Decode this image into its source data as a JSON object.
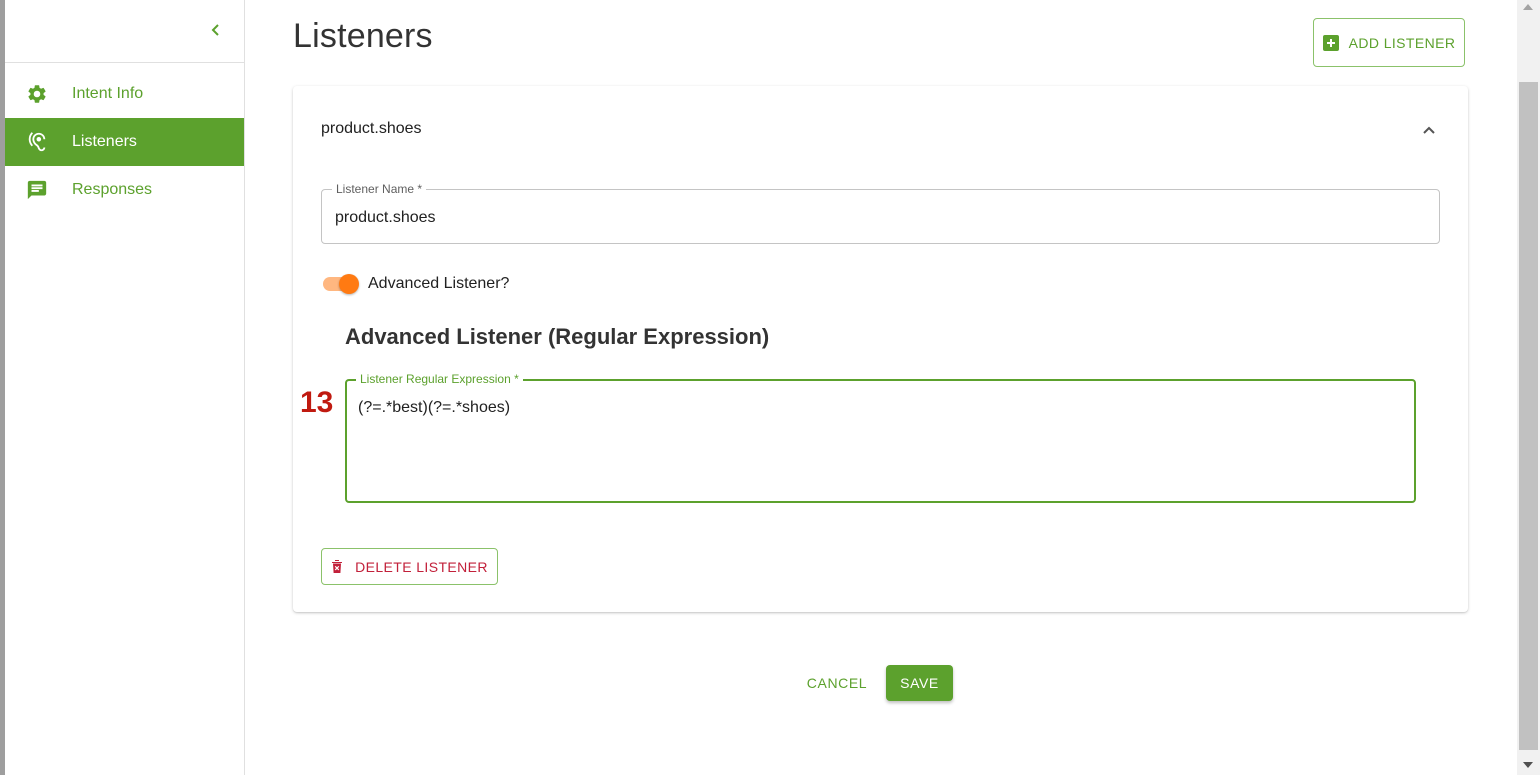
{
  "sidebar": {
    "items": [
      {
        "label": "Intent Info",
        "icon": "gear-icon",
        "active": false
      },
      {
        "label": "Listeners",
        "icon": "ear-icon",
        "active": true
      },
      {
        "label": "Responses",
        "icon": "message-icon",
        "active": false
      }
    ]
  },
  "header": {
    "title": "Listeners",
    "add_label": "ADD LISTENER"
  },
  "listener": {
    "title": "product.shoes",
    "name_label": "Listener Name *",
    "name_value": "product.shoes",
    "advanced_toggle_label": "Advanced Listener?",
    "advanced_toggle_on": true,
    "advanced_heading": "Advanced Listener (Regular Expression)",
    "regex_label": "Listener Regular Expression *",
    "regex_value": "(?=.*best)(?=.*shoes)",
    "delete_label": "DELETE LISTENER"
  },
  "annotation": {
    "marker": "13"
  },
  "actions": {
    "cancel_label": "CANCEL",
    "save_label": "SAVE"
  },
  "colors": {
    "accent": "#5ca12d",
    "toggle": "#ff7a12",
    "danger": "#c2203a",
    "marker": "#c01a10"
  }
}
